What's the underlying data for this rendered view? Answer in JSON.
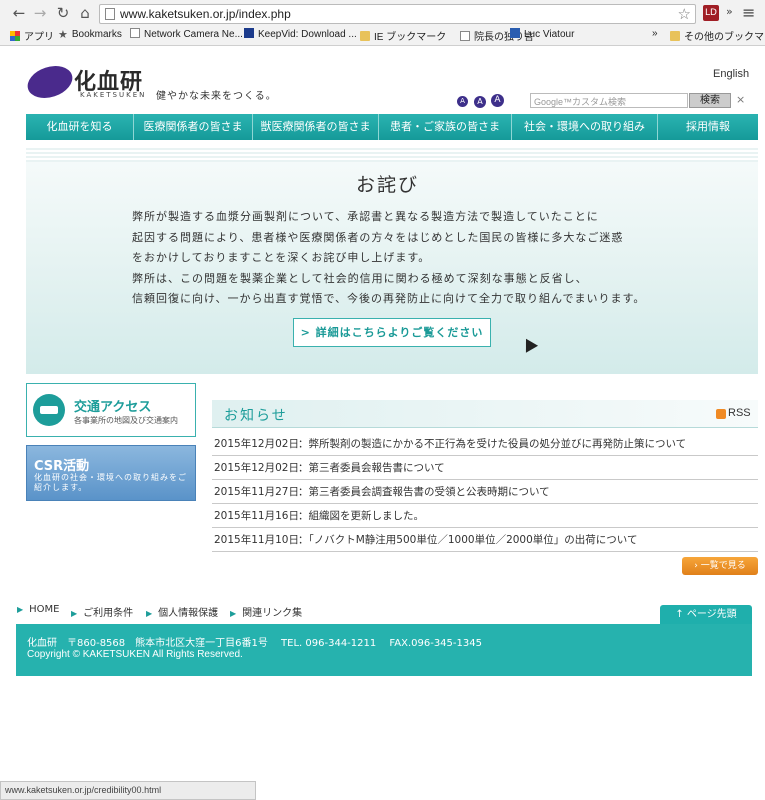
{
  "browser": {
    "url": "www.kaketsuken.or.jp/index.php",
    "bookmarks": [
      {
        "label": "アプリ",
        "icon": "apps-grid-icon"
      },
      {
        "label": "Bookmarks",
        "icon": "star-icon"
      },
      {
        "label": "Network Camera Ne...",
        "icon": "page-icon"
      },
      {
        "label": "KeepVid: Download ...",
        "icon": "kv-icon"
      },
      {
        "label": "IE ブックマーク",
        "icon": "folder-icon"
      },
      {
        "label": "院長の独り言",
        "icon": "page-icon"
      },
      {
        "label": "Luc Viatour",
        "icon": "pc-icon"
      },
      {
        "label": "その他のブックマーク",
        "icon": "folder-icon"
      }
    ],
    "chevron": "»",
    "ext_badge": "LD"
  },
  "header": {
    "logo_text": "化血研",
    "logo_sub": "KAKETSUKEN",
    "tagline": "健やかな未来をつくる。",
    "english_link": "English",
    "font_sizes": [
      "A",
      "A",
      "A"
    ],
    "search_placeholder": "Google™カスタム検索",
    "search_button": "検索",
    "search_clear": "×"
  },
  "nav": [
    "化血研を知る",
    "医療関係者の皆さま",
    "獣医療関係者の皆さま",
    "患者・ご家族の皆さま",
    "社会・環境への取り組み",
    "採用情報"
  ],
  "apology": {
    "title": "お詫び",
    "lines": [
      "弊所が製造する血漿分画製剤について、承認書と異なる製造方法で製造していたことに",
      "起因する問題により、患者様や医療関係者の方々をはじめとした国民の皆様に多大なご迷惑",
      "をおかけしておりますことを深くお詫び申し上げます。",
      "弊所は、この問題を製薬企業として社会的信用に関わる極めて深刻な事態と反省し、",
      "信頼回復に向け、一から出直す覚悟で、今後の再発防止に向けて全力で取り組んでまいります。"
    ],
    "detail_button": "> 詳細はこちらよりご覧ください"
  },
  "side": {
    "access_title": "交通アクセス",
    "access_sub": "各事業所の地図及び交通案内",
    "csr_title": "CSR活動",
    "csr_sub": "化血研の社会・環境への取り組みをご紹介します。"
  },
  "news": {
    "title": "お知らせ",
    "rss": "RSS",
    "items": [
      {
        "date": "2015年12月02日",
        "text": "：弊所製剤の製造にかかる不正行為を受けた役員の処分並びに再発防止策について"
      },
      {
        "date": "2015年12月02日",
        "text": "：第三者委員会報告書について"
      },
      {
        "date": "2015年11月27日",
        "text": "：第三者委員会調査報告書の受領と公表時期について"
      },
      {
        "date": "2015年11月16日",
        "text": "：組織図を更新しました。"
      },
      {
        "date": "2015年11月10日",
        "text": "：「ノバクトM静注用500単位／1000単位／2000単位」の出荷について"
      }
    ],
    "list_button": "一覧で見る"
  },
  "footer": {
    "links": [
      "HOME",
      "ご利用条件",
      "個人情報保護",
      "関連リンク集"
    ],
    "pagetop": "ページ先頭",
    "address": "化血研　〒860-8568　熊本市北区大窪一丁目6番1号　 TEL. 096-344-1211　 FAX.096-345-1345",
    "copyright": "Copyright © KAKETSUKEN All Rights Reserved."
  },
  "status_url": "www.kaketsuken.or.jp/credibility00.html",
  "colors": {
    "brand_teal": "#1fafac",
    "logo_purple": "#4a2a8c",
    "accent_orange": "#e0801a"
  }
}
